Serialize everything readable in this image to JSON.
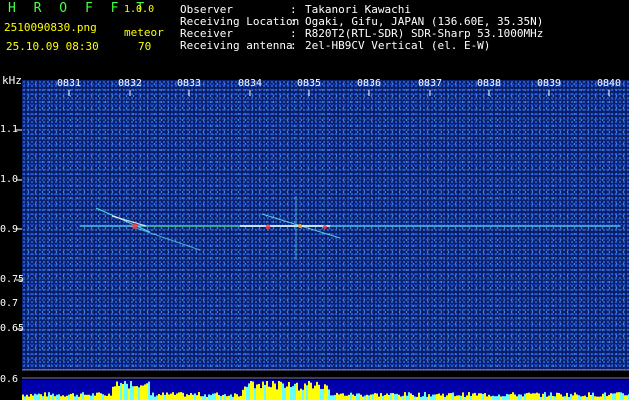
{
  "header": {
    "app_title": "H R O F F T",
    "version": "1.0.0",
    "filename": "2510090830.png",
    "timestamp": "25.10.09 08:30",
    "mode_label": "meteor",
    "mode_count": "70"
  },
  "meta": [
    {
      "key": "Observer",
      "value": "Takanori Kawachi"
    },
    {
      "key": "Receiving Location",
      "value": "Ogaki, Gifu, JAPAN (136.60E, 35.35N)"
    },
    {
      "key": "Receiver",
      "value": "R820T2(RTL-SDR) SDR-Sharp 53.1000MHz"
    },
    {
      "key": "Receiving antenna",
      "value": "2el-HB9CV Vertical (el. E-W)"
    }
  ],
  "axis": {
    "unit_label": "kHz",
    "time_ticks": [
      "0831",
      "0832",
      "0833",
      "0834",
      "0835",
      "0836",
      "0837",
      "0838",
      "0839",
      "0840"
    ],
    "freq_ticks": [
      "1.1",
      "1.0",
      "0.9",
      "0.75",
      "0.7",
      "0.65",
      "0.6"
    ]
  },
  "colors": {
    "trace_green": "#44ff44",
    "signal_cyan": "#66ffff",
    "noise_blue": "#1e4ad6",
    "level_yellow": "#ffff00"
  }
}
